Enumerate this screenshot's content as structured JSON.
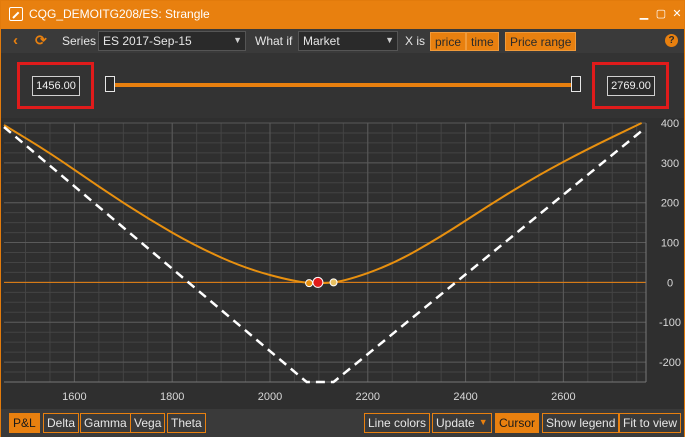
{
  "window": {
    "title": "CQG_DEMOITG208/ES: Strangle"
  },
  "toolbar": {
    "series_label": "Series",
    "series_value": "ES 2017-Sep-15",
    "whatif_label": "What if",
    "whatif_value": "Market",
    "xis_label": "X is",
    "price_toggle": "price",
    "time_toggle": "time",
    "price_range_button": "Price range"
  },
  "range": {
    "min_value": "1456.00",
    "max_value": "2769.00"
  },
  "chart_data": {
    "type": "line",
    "x_ticks": [
      1600,
      1800,
      2000,
      2200,
      2400,
      2600
    ],
    "y_ticks": [
      400,
      300,
      200,
      100,
      0,
      -100,
      -200
    ],
    "xlim": [
      1456,
      2769
    ],
    "ylim": [
      -250,
      400
    ],
    "series": [
      {
        "style": "curve",
        "color": "#e8900f",
        "x": [
          1456,
          1550,
          1650,
          1750,
          1850,
          1950,
          2050,
          2100,
          2150,
          2250,
          2350,
          2450,
          2550,
          2650,
          2760
        ],
        "y": [
          395,
          325,
          240,
          160,
          90,
          35,
          2,
          -3,
          2,
          45,
          115,
          195,
          270,
          335,
          400
        ]
      },
      {
        "style": "dashed",
        "color": "#ffffff",
        "x": [
          1456,
          2075,
          2130,
          2760
        ],
        "y": [
          390,
          -250,
          -250,
          380
        ]
      }
    ],
    "markers": [
      {
        "x": 2080,
        "y": -2,
        "color": "#e8900f"
      },
      {
        "x": 2098,
        "y": 0,
        "color": "#e01b1b"
      },
      {
        "x": 2130,
        "y": 0,
        "color": "#e8c060"
      }
    ],
    "grid": true,
    "zero_line_color": "#e8800f"
  },
  "bottom": {
    "tabs": [
      "P&L",
      "Delta",
      "Gamma",
      "Vega",
      "Theta"
    ],
    "line_colors": "Line colors",
    "update": "Update",
    "cursor": "Cursor",
    "show_legend": "Show legend",
    "fit_to_view": "Fit to view"
  }
}
